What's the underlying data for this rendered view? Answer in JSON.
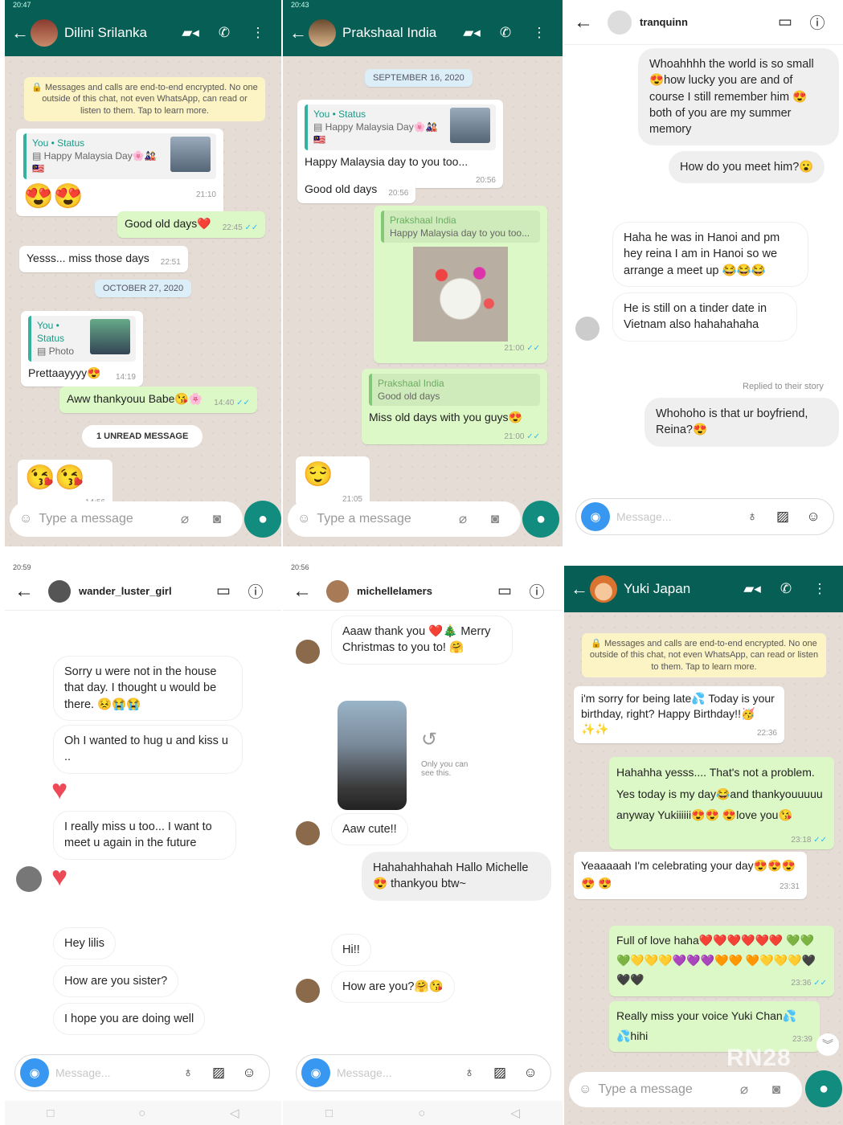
{
  "p1": {
    "status_time": "20:47",
    "contact": "Dilini Srilanka",
    "encryption": "🔒 Messages and calls are end-to-end encrypted. No one outside of this chat, not even WhatsApp, can read or listen to them. Tap to learn more.",
    "m1_sender": "You • Status",
    "m1_quote": "▤ Happy Malaysia Day🌸🎎🇲🇾",
    "m1_text": "😍😍",
    "m1_time": "21:10",
    "m2_text": "Good old days❤️",
    "m2_time": "22:45",
    "m3_text": "Yesss... miss those days",
    "m3_time": "22:51",
    "date1": "OCTOBER 27, 2020",
    "m4_sender": "You • Status",
    "m4_quote": "▤ Photo",
    "m4_text": "Prettaayyyy😍",
    "m4_time": "14:19",
    "m5_text": "Aww thankyouu Babe😘🌸",
    "m5_time": "14:40",
    "unread": "1 UNREAD MESSAGE",
    "m6_text": "😘😘",
    "m6_time": "14:56",
    "placeholder": "Type a message"
  },
  "p2": {
    "status_time": "20:43",
    "contact": "Prakshaal India",
    "date1": "SEPTEMBER 16, 2020",
    "m1_sender": "You • Status",
    "m1_quote": "▤ Happy Malaysia Day🌸🎎🇲🇾",
    "m1_text": "Happy Malaysia day to you too...",
    "m1_time": "20:56",
    "m2_text": "Good old days",
    "m2_time": "20:56",
    "m3_sender": "Prakshaal India",
    "m3_quote": "Happy Malaysia day to you too...",
    "m3_time": "21:00",
    "m4_sender": "Prakshaal India",
    "m4_quote": "Good old days",
    "m4_text": "Miss old days with you guys😍",
    "m4_time": "21:00",
    "m5_text": "😌",
    "m5_time": "21:05",
    "placeholder": "Type a message"
  },
  "p3": {
    "username": "tranquinn",
    "m1": "Whoahhhh the world is so small😍how lucky you are and of course I still remember him 😍both of you are my summer memory",
    "m2": "How do you meet him?😮",
    "m3": "Haha he was in Hanoi and pm hey reina I am in Hanoi so we arrange a meet up 😂😂😂",
    "m4": "He is still on a tinder date in Vietnam also hahahahaha",
    "replied": "Replied to their story",
    "m5": "Whohoho is that ur boyfriend, Reina?😍",
    "placeholder": "Message..."
  },
  "p4": {
    "status_time": "20:59",
    "username": "wander_luster_girl",
    "m1": "Sorry u were not in the house that day. I thought u would be there. 😣😭😭",
    "m2": "Oh I wanted to hug u and kiss u ..",
    "m3": "I really miss u too... I want to meet u again in the future",
    "m4": "Hey lilis",
    "m5": "How are you sister?",
    "m6": "I hope you are doing well",
    "placeholder": "Message..."
  },
  "p5": {
    "status_time": "20:56",
    "username": "michellelamers",
    "m1": "Aaaw thank you ❤️🎄 Merry Christmas to you to! 🤗",
    "only": "Only you can see this.",
    "m2": "Aaw cute!!",
    "m3": "Hahahahhahah Hallo Michelle 😍 thankyou btw~",
    "m4": "Hi!!",
    "m5": "How are you?🤗😘",
    "placeholder": "Message..."
  },
  "p6": {
    "contact": "Yuki Japan",
    "encryption": "🔒 Messages and calls are end-to-end encrypted. No one outside of this chat, not even WhatsApp, can read or listen to them. Tap to learn more.",
    "m1": "i'm sorry for being late💦 Today is your birthday, right? Happy Birthday!!🥳✨✨",
    "m1_time": "22:36",
    "m2": "Hahahha yesss.... That's not a problem. Yes today is my day😂and thankyouuuuu anyway Yukiiiiii😍😍 😍love you😘",
    "m2_time": "23:18",
    "m3": "Yeaaaaah I'm celebrating your day😍😍😍😍 😍",
    "m3_time": "23:31",
    "m4": "Full of love haha❤️❤️❤️❤️❤️❤️ 💚💚💚💛💛💛💜💜💜🧡🧡 🧡💛💛💛🖤🖤🖤",
    "m4_time": "23:36",
    "m5": "Really miss your voice Yuki Chan💦 💦hihi",
    "m5_time": "23:39",
    "placeholder": "Type a message",
    "watermark": "RN28"
  },
  "colors": {
    "wa_green": "#075e54",
    "wa_out": "#dcf8c6",
    "ig_blue": "#3897f0"
  }
}
